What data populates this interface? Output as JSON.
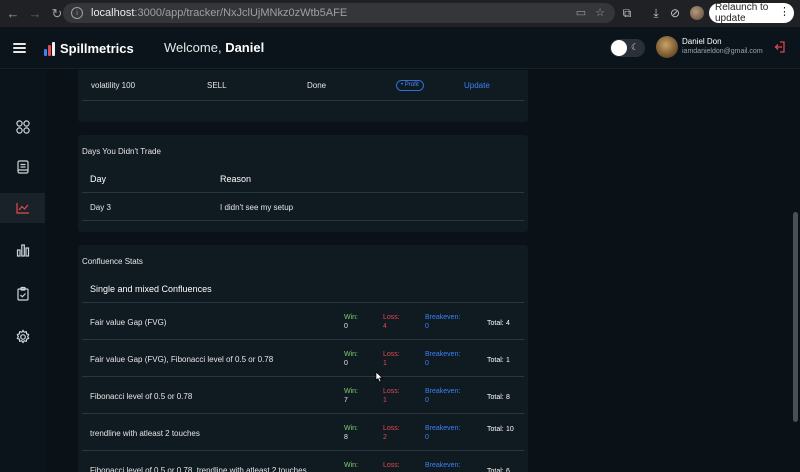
{
  "browser": {
    "url_host": "localhost",
    "url_path": ":3000/app/tracker/NxJclUjMNkz0zWtb5AFE",
    "relaunch_label": "Relaunch to update"
  },
  "header": {
    "brand": "Spillmetrics",
    "welcome_prefix": "Welcome,",
    "welcome_name": "Daniel",
    "user_name": "Daniel Don",
    "user_email": "iamdanieldon@gmail.com"
  },
  "sidebar": {
    "items": [
      "dashboard",
      "journal",
      "tracker",
      "analytics",
      "checklist",
      "settings"
    ],
    "active": "tracker"
  },
  "trades_card": {
    "row": {
      "pair": "volatility 100",
      "direction": "SELL",
      "status": "Done",
      "result": "• Profit",
      "action": "Update"
    }
  },
  "no_trade_card": {
    "title": "Days You Didn't Trade",
    "headers": {
      "day": "Day",
      "reason": "Reason"
    },
    "rows": [
      {
        "day": "Day 3",
        "reason": "I didn't see my setup"
      }
    ]
  },
  "confluence_card": {
    "title": "Confluence Stats",
    "subtitle": "Single and mixed Confluences",
    "labels": {
      "win": "Win:",
      "loss": "Loss:",
      "breakeven": "Breakeven:",
      "total": "Total:"
    },
    "rows": [
      {
        "name": "Fair value Gap (FVG)",
        "win": "0",
        "loss": "4",
        "breakeven": "0",
        "total": "4"
      },
      {
        "name": "Fair value Gap (FVG), Fibonacci level of 0.5 or 0.78",
        "win": "0",
        "loss": "1",
        "breakeven": "0",
        "total": "1"
      },
      {
        "name": "Fibonacci level of 0.5 or 0.78",
        "win": "7",
        "loss": "1",
        "breakeven": "0",
        "total": "8"
      },
      {
        "name": "trendline with atleast 2 touches",
        "win": "8",
        "loss": "2",
        "breakeven": "0",
        "total": "10"
      },
      {
        "name": "Fibonacci level of 0.5 or 0.78, trendline with atleast 2 touches",
        "win": "",
        "loss": "",
        "breakeven": "",
        "total": "6"
      }
    ]
  },
  "colors": {
    "win": "#7fcf6e",
    "loss": "#e5484d",
    "breakeven": "#3b82f6",
    "accent": "#3b82f6"
  }
}
